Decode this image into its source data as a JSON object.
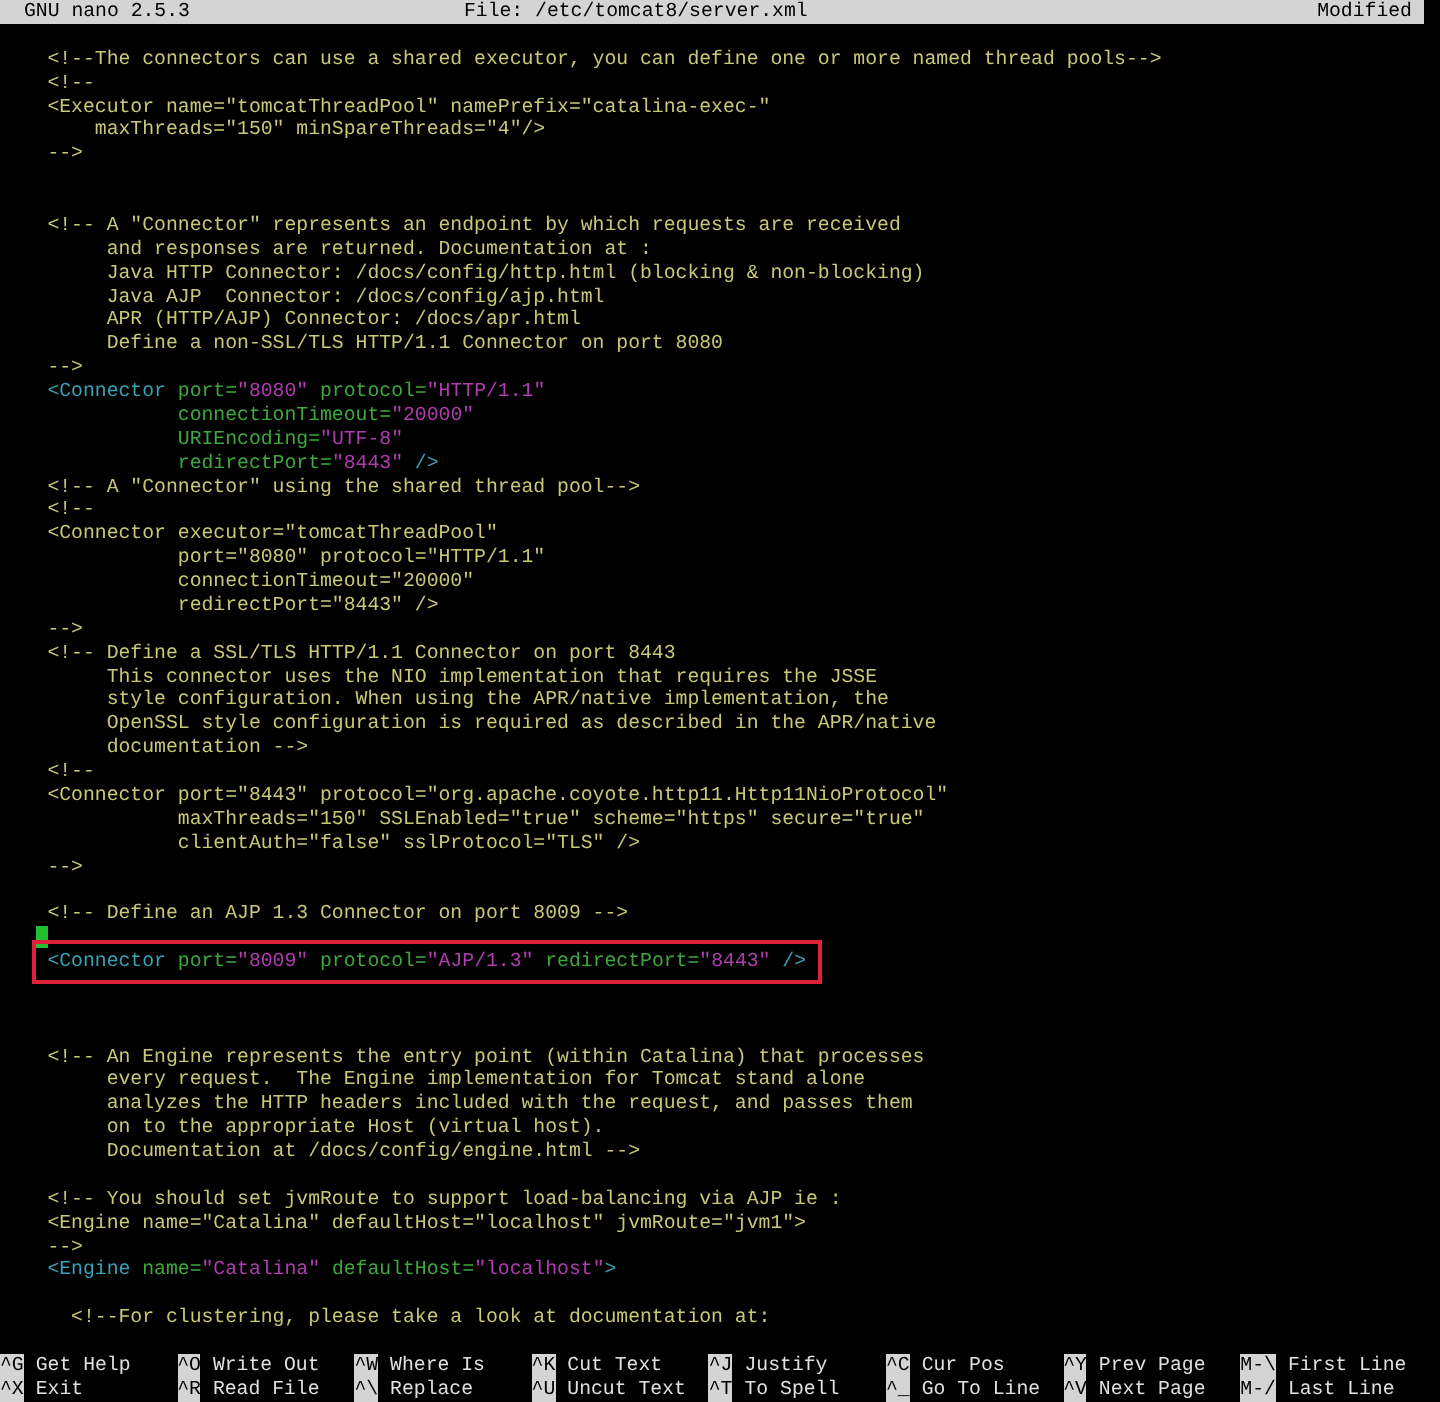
{
  "title_bar": {
    "app": "GNU nano 2.5.3",
    "file": "File: /etc/tomcat8/server.xml",
    "status": "Modified"
  },
  "editor": {
    "lines": [
      {
        "kind": "text",
        "text": "    <!--The connectors can use a shared executor, you can define one or more named thread pools-->"
      },
      {
        "kind": "text",
        "text": "    <!--"
      },
      {
        "kind": "text",
        "text": "    <Executor name=\"tomcatThreadPool\" namePrefix=\"catalina-exec-\""
      },
      {
        "kind": "text",
        "text": "        maxThreads=\"150\" minSpareThreads=\"4\"/>"
      },
      {
        "kind": "text",
        "text": "    -->"
      },
      {
        "kind": "blank"
      },
      {
        "kind": "blank"
      },
      {
        "kind": "text",
        "text": "    <!-- A \"Connector\" represents an endpoint by which requests are received"
      },
      {
        "kind": "text",
        "text": "         and responses are returned. Documentation at :"
      },
      {
        "kind": "text",
        "text": "         Java HTTP Connector: /docs/config/http.html (blocking & non-blocking)"
      },
      {
        "kind": "text",
        "text": "         Java AJP  Connector: /docs/config/ajp.html"
      },
      {
        "kind": "text",
        "text": "         APR (HTTP/AJP) Connector: /docs/apr.html"
      },
      {
        "kind": "text",
        "text": "         Define a non-SSL/TLS HTTP/1.1 Connector on port 8080"
      },
      {
        "kind": "text",
        "text": "    -->"
      },
      {
        "kind": "code",
        "highlighted": false,
        "segments": [
          {
            "kind": "tag",
            "text": "    <Connector"
          },
          {
            "kind": "attr",
            "text": " port="
          },
          {
            "kind": "value",
            "text": "\"8080\""
          },
          {
            "kind": "attr",
            "text": " protocol="
          },
          {
            "kind": "value",
            "text": "\"HTTP/1.1\""
          }
        ]
      },
      {
        "kind": "code",
        "highlighted": false,
        "segments": [
          {
            "kind": "attr",
            "text": "               connectionTimeout="
          },
          {
            "kind": "value",
            "text": "\"20000\""
          }
        ]
      },
      {
        "kind": "code",
        "highlighted": false,
        "segments": [
          {
            "kind": "attr",
            "text": "               URIEncoding="
          },
          {
            "kind": "value",
            "text": "\"UTF-8\""
          }
        ]
      },
      {
        "kind": "code",
        "highlighted": false,
        "segments": [
          {
            "kind": "attr",
            "text": "               redirectPort="
          },
          {
            "kind": "value",
            "text": "\"8443\""
          },
          {
            "kind": "tag",
            "text": " />"
          }
        ]
      },
      {
        "kind": "text",
        "text": "    <!-- A \"Connector\" using the shared thread pool-->"
      },
      {
        "kind": "text",
        "text": "    <!--"
      },
      {
        "kind": "text",
        "text": "    <Connector executor=\"tomcatThreadPool\""
      },
      {
        "kind": "text",
        "text": "               port=\"8080\" protocol=\"HTTP/1.1\""
      },
      {
        "kind": "text",
        "text": "               connectionTimeout=\"20000\""
      },
      {
        "kind": "text",
        "text": "               redirectPort=\"8443\" />"
      },
      {
        "kind": "text",
        "text": "    -->"
      },
      {
        "kind": "text",
        "text": "    <!-- Define a SSL/TLS HTTP/1.1 Connector on port 8443"
      },
      {
        "kind": "text",
        "text": "         This connector uses the NIO implementation that requires the JSSE"
      },
      {
        "kind": "text",
        "text": "         style configuration. When using the APR/native implementation, the"
      },
      {
        "kind": "text",
        "text": "         OpenSSL style configuration is required as described in the APR/native"
      },
      {
        "kind": "text",
        "text": "         documentation -->"
      },
      {
        "kind": "text",
        "text": "    <!--"
      },
      {
        "kind": "text",
        "text": "    <Connector port=\"8443\" protocol=\"org.apache.coyote.http11.Http11NioProtocol\""
      },
      {
        "kind": "text",
        "text": "               maxThreads=\"150\" SSLEnabled=\"true\" scheme=\"https\" secure=\"true\""
      },
      {
        "kind": "text",
        "text": "               clientAuth=\"false\" sslProtocol=\"TLS\" />"
      },
      {
        "kind": "text",
        "text": "    -->"
      },
      {
        "kind": "blank"
      },
      {
        "kind": "text",
        "text": "    <!-- Define an AJP 1.3 Connector on port 8009 -->"
      },
      {
        "kind": "cursor"
      },
      {
        "kind": "code",
        "highlighted": true,
        "segments": [
          {
            "kind": "tag",
            "text": "    <Connector"
          },
          {
            "kind": "attr",
            "text": " port="
          },
          {
            "kind": "value",
            "text": "\"8009\""
          },
          {
            "kind": "attr",
            "text": " protocol="
          },
          {
            "kind": "value",
            "text": "\"AJP/1.3\""
          },
          {
            "kind": "attr",
            "text": " redirectPort="
          },
          {
            "kind": "value",
            "text": "\"8443\""
          },
          {
            "kind": "tag",
            "text": " />"
          }
        ]
      },
      {
        "kind": "blank"
      },
      {
        "kind": "blank"
      },
      {
        "kind": "blank"
      },
      {
        "kind": "text",
        "text": "    <!-- An Engine represents the entry point (within Catalina) that processes"
      },
      {
        "kind": "text",
        "text": "         every request.  The Engine implementation for Tomcat stand alone"
      },
      {
        "kind": "text",
        "text": "         analyzes the HTTP headers included with the request, and passes them"
      },
      {
        "kind": "text",
        "text": "         on to the appropriate Host (virtual host)."
      },
      {
        "kind": "text",
        "text": "         Documentation at /docs/config/engine.html -->"
      },
      {
        "kind": "blank"
      },
      {
        "kind": "text",
        "text": "    <!-- You should set jvmRoute to support load-balancing via AJP ie :"
      },
      {
        "kind": "text",
        "text": "    <Engine name=\"Catalina\" defaultHost=\"localhost\" jvmRoute=\"jvm1\">"
      },
      {
        "kind": "text",
        "text": "    -->"
      },
      {
        "kind": "code",
        "highlighted": false,
        "segments": [
          {
            "kind": "tag",
            "text": "    <Engine"
          },
          {
            "kind": "attr",
            "text": " name="
          },
          {
            "kind": "value",
            "text": "\"Catalina\""
          },
          {
            "kind": "attr",
            "text": " defaultHost="
          },
          {
            "kind": "value",
            "text": "\"localhost\""
          },
          {
            "kind": "tag",
            "text": ">"
          }
        ]
      },
      {
        "kind": "blank"
      },
      {
        "kind": "text",
        "text": "      <!--For clustering, please take a look at documentation at:"
      }
    ]
  },
  "shortcuts": [
    {
      "key": "^G",
      "label": "Get Help"
    },
    {
      "key": "^O",
      "label": "Write Out"
    },
    {
      "key": "^W",
      "label": "Where Is"
    },
    {
      "key": "^K",
      "label": "Cut Text"
    },
    {
      "key": "^J",
      "label": "Justify"
    },
    {
      "key": "^C",
      "label": "Cur Pos"
    },
    {
      "key": "^Y",
      "label": "Prev Page"
    },
    {
      "key": "M-\\",
      "label": "First Line"
    },
    {
      "key": "^X",
      "label": "Exit"
    },
    {
      "key": "^R",
      "label": "Read File"
    },
    {
      "key": "^\\",
      "label": "Replace"
    },
    {
      "key": "^U",
      "label": "Uncut Text"
    },
    {
      "key": "^T",
      "label": "To Spell"
    },
    {
      "key": "^_",
      "label": "Go To Line"
    },
    {
      "key": "^V",
      "label": "Next Page"
    },
    {
      "key": "M-/",
      "label": "Last Line"
    }
  ]
}
